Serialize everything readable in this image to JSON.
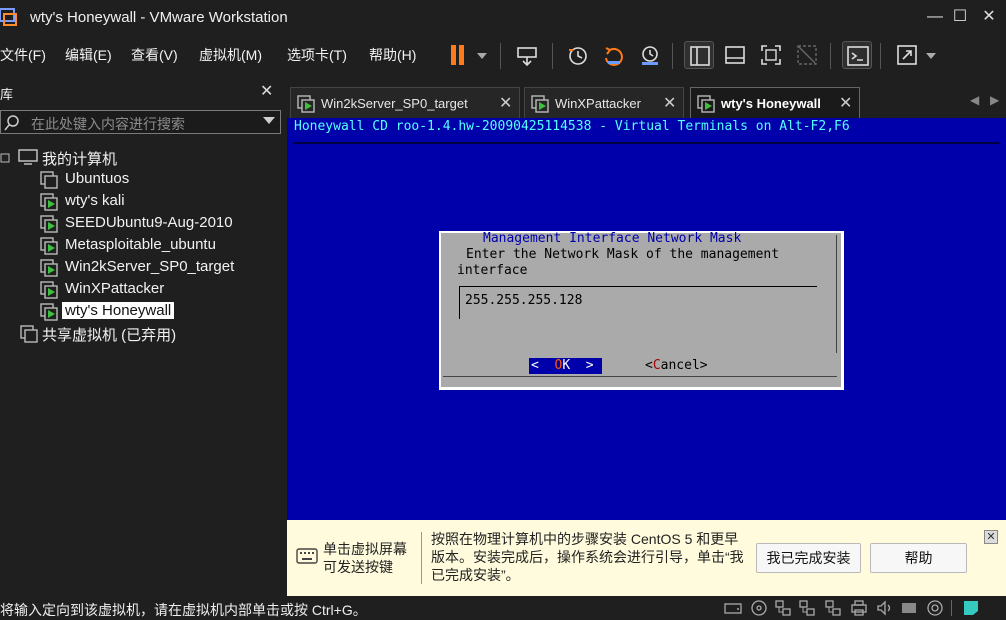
{
  "window": {
    "title": "wty's Honeywall - VMware Workstation",
    "minimize": "—",
    "maximize": "☐",
    "close": "✕"
  },
  "menu": [
    {
      "label": "文件(F)"
    },
    {
      "label": "编辑(E)"
    },
    {
      "label": "查看(V)"
    },
    {
      "label": "虚拟机(M)"
    },
    {
      "label": "选项卡(T)"
    },
    {
      "label": "帮助(H)"
    }
  ],
  "colors": {
    "accent_orange": "#ff7a1a",
    "vm_blue": "#0000aa",
    "hint_bg": "#fffbdc"
  },
  "sidebar": {
    "title": "库",
    "close": "✕",
    "search_placeholder": "在此处键入内容进行搜索",
    "root_label": "我的计算机",
    "items": [
      {
        "label": "Ubuntuos",
        "running": false
      },
      {
        "label": "wty's kali",
        "running": true
      },
      {
        "label": "SEEDUbuntu9-Aug-2010",
        "running": true
      },
      {
        "label": "Metasploitable_ubuntu",
        "running": true
      },
      {
        "label": "Win2kServer_SP0_target",
        "running": true
      },
      {
        "label": "WinXPattacker",
        "running": true
      },
      {
        "label": "wty's Honeywall",
        "running": true,
        "selected": true
      }
    ],
    "shared_label": "共享虚拟机 (已弃用)"
  },
  "tabs": [
    {
      "label": "Win2kServer_SP0_target",
      "close": "✕"
    },
    {
      "label": "WinXPattacker",
      "close": "✕"
    },
    {
      "label": "wty's Honeywall",
      "close": "✕",
      "active": true
    }
  ],
  "tab_nav": {
    "prev": "◀",
    "next": "▶"
  },
  "vm_console": {
    "header": "Honeywall CD roo-1.4.hw-20090425114538 - Virtual Terminals on Alt-F2,F6",
    "dialog": {
      "title": "Management Interface Network Mask",
      "line1": "Enter the Network Mask of the management",
      "line2": "interface",
      "input_value": "255.255.255.128",
      "ok_pre": "<  ",
      "ok_hot": "O",
      "ok_post": "K  >",
      "cancel_pre": "<",
      "cancel_hot": "C",
      "cancel_post": "ancel>"
    }
  },
  "hint": {
    "left_text": "单击虚拟屏幕可发送按键",
    "main_text": "按照在物理计算机中的步骤安装 CentOS 5 和更早版本。安装完成后，操作系统会进行引导，单击“我已完成安装”。",
    "done_button": "我已完成安装",
    "help_button": "帮助",
    "close": "✕"
  },
  "status": {
    "text": "将输入定向到该虚拟机，请在虚拟机内部单击或按 Ctrl+G。"
  }
}
